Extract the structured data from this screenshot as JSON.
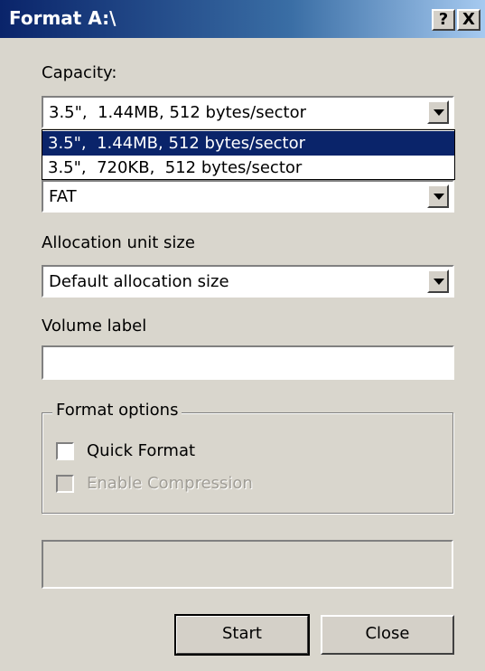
{
  "window": {
    "title": "Format A:\\",
    "help_label": "?",
    "close_label": "X"
  },
  "capacity": {
    "label": "Capacity:",
    "value": "3.5\",  1.44MB, 512 bytes/sector",
    "options": [
      "3.5\",  1.44MB, 512 bytes/sector",
      "3.5\",  720KB,  512 bytes/sector"
    ]
  },
  "file_system": {
    "value": "FAT"
  },
  "allocation": {
    "label": "Allocation unit size",
    "value": "Default allocation size"
  },
  "volume_label": {
    "label": "Volume label",
    "value": ""
  },
  "format_options": {
    "legend": "Format options",
    "quick_format": {
      "label": "Quick Format",
      "checked": false
    },
    "enable_compression": {
      "label": "Enable Compression",
      "checked": false,
      "disabled": true
    }
  },
  "buttons": {
    "start": "Start",
    "close": "Close"
  },
  "colors": {
    "title_bar": "#0a246a",
    "selection": "#0a246a",
    "dialog_bg": "#d9d6cd"
  }
}
